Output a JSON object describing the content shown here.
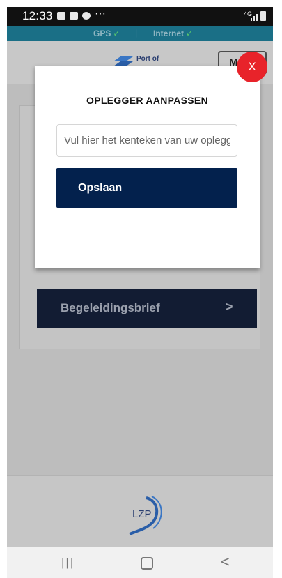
{
  "status_bar": {
    "time": "12:33",
    "more": "···",
    "network": "4G"
  },
  "connectivity": {
    "gps_label": "GPS",
    "separator": "|",
    "internet_label": "Internet",
    "check_glyph": "✓",
    "ok_color": "#56c56d"
  },
  "header": {
    "logo_text": "Port of",
    "menu_label": "M"
  },
  "main": {
    "begeleidingsbrief_label": "Begeleidingsbrief",
    "chevron": ">"
  },
  "modal": {
    "title": "OPLEGGER AANPASSEN",
    "plate_placeholder": "Vul hier het kenteken van uw oplegger in",
    "plate_value": "",
    "save_label": "Opslaan",
    "close_label": "X",
    "close_color": "#e8232a",
    "save_color": "#03214d"
  },
  "footer": {
    "logo_text": "LZP"
  },
  "nav_bar": {
    "recent_glyph": "|||",
    "back_glyph": "<"
  }
}
